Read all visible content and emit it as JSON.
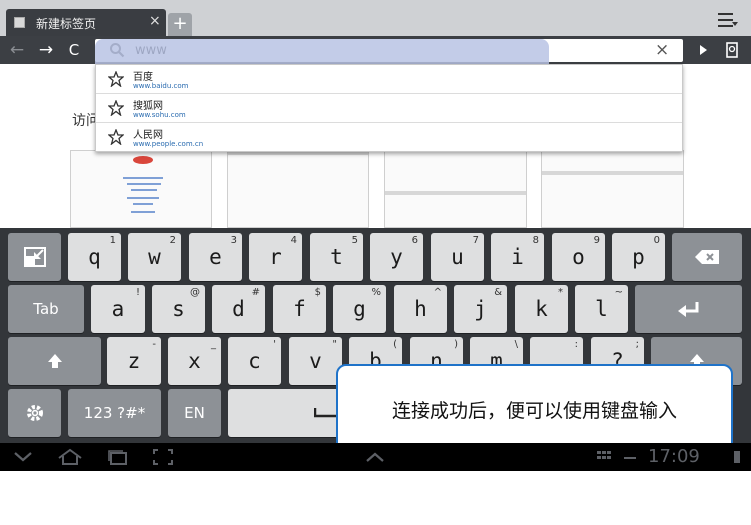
{
  "browser": {
    "tab_title": "新建标签页",
    "tab_close": "×",
    "new_tab": "+",
    "url_value": "www",
    "url_clear": "×"
  },
  "page": {
    "visit_label": "访问"
  },
  "suggestions": [
    {
      "title": "百度",
      "url": "www.baidu.com"
    },
    {
      "title": "搜狐网",
      "url": "www.sohu.com"
    },
    {
      "title": "人民网",
      "url": "www.people.com.cn"
    }
  ],
  "keyboard": {
    "row1": [
      {
        "label": "q",
        "hint": "1"
      },
      {
        "label": "w",
        "hint": "2"
      },
      {
        "label": "e",
        "hint": "3"
      },
      {
        "label": "r",
        "hint": "4"
      },
      {
        "label": "t",
        "hint": "5"
      },
      {
        "label": "y",
        "hint": "6"
      },
      {
        "label": "u",
        "hint": "7"
      },
      {
        "label": "i",
        "hint": "8"
      },
      {
        "label": "o",
        "hint": "9"
      },
      {
        "label": "p",
        "hint": "0"
      }
    ],
    "row2": [
      {
        "label": "a",
        "hint": "!"
      },
      {
        "label": "s",
        "hint": "@"
      },
      {
        "label": "d",
        "hint": "#"
      },
      {
        "label": "f",
        "hint": "$"
      },
      {
        "label": "g",
        "hint": "%"
      },
      {
        "label": "h",
        "hint": "^"
      },
      {
        "label": "j",
        "hint": "&"
      },
      {
        "label": "k",
        "hint": "*"
      },
      {
        "label": "l",
        "hint": "~"
      }
    ],
    "row3": [
      {
        "label": "z",
        "hint": "-"
      },
      {
        "label": "x",
        "hint": "_"
      },
      {
        "label": "c",
        "hint": "'"
      },
      {
        "label": "v",
        "hint": "\""
      },
      {
        "label": "b",
        "hint": "("
      },
      {
        "label": "n",
        "hint": ")"
      },
      {
        "label": "m",
        "hint": "\\"
      },
      {
        "label": "",
        "hint": ":"
      },
      {
        "label": "?",
        "hint": ";"
      }
    ],
    "tab_label": "Tab",
    "symbols_label": "123 ?#*",
    "lang_label": "EN"
  },
  "callout": {
    "text": "连接成功后，便可以使用键盘输入"
  },
  "status": {
    "clock": "17:09"
  },
  "colors": {
    "accent": "#1f73c9",
    "toolbar": "#3c3f44",
    "key_light": "#dedfe0",
    "key_dark": "#8d9196"
  }
}
